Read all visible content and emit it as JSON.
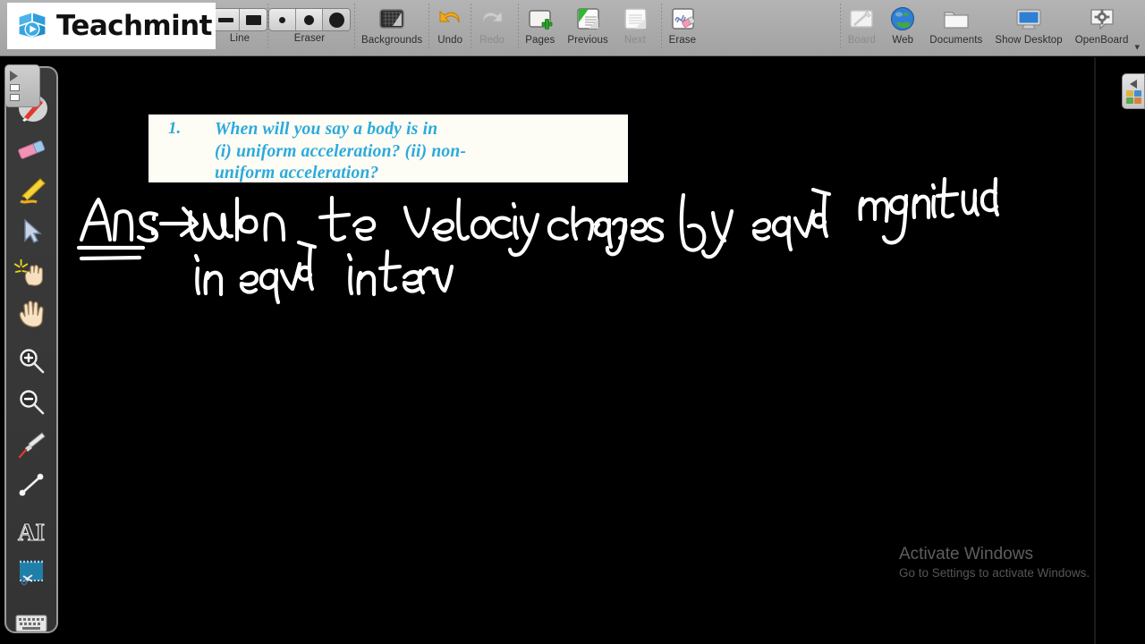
{
  "app": {
    "brand": "Teachmint"
  },
  "toolbar": {
    "groups": [
      {
        "name": "line",
        "label": "Line",
        "icon": "line-width-icon",
        "options": [
          "thin-line",
          "thick-line"
        ],
        "selected": 1
      },
      {
        "name": "eraser",
        "label": "Eraser",
        "icon": "eraser-size-icon",
        "options": [
          "small-dot",
          "medium-dot",
          "large-dot"
        ],
        "selected": 2
      },
      {
        "name": "backgrounds",
        "label": "Backgrounds",
        "icon": "grid-background-icon",
        "disabled": false
      },
      {
        "name": "undo",
        "label": "Undo",
        "icon": "undo-arrow-icon",
        "disabled": false
      },
      {
        "name": "redo",
        "label": "Redo",
        "icon": "redo-arrow-icon",
        "disabled": true
      },
      {
        "name": "pages",
        "label": "Pages",
        "icon": "add-page-icon",
        "disabled": false
      },
      {
        "name": "previous",
        "label": "Previous",
        "icon": "previous-page-icon",
        "disabled": false
      },
      {
        "name": "next",
        "label": "Next",
        "icon": "next-page-icon",
        "disabled": true
      },
      {
        "name": "erase",
        "label": "Erase",
        "icon": "erase-all-icon",
        "disabled": false
      },
      {
        "name": "board",
        "label": "Board",
        "icon": "board-icon",
        "disabled": true
      },
      {
        "name": "web",
        "label": "Web",
        "icon": "globe-icon",
        "disabled": false
      },
      {
        "name": "documents",
        "label": "Documents",
        "icon": "folder-icon",
        "disabled": false
      },
      {
        "name": "show-desktop",
        "label": "Show Desktop",
        "icon": "monitor-icon",
        "disabled": false
      },
      {
        "name": "openboard",
        "label": "OpenBoard",
        "icon": "gear-speech-icon",
        "disabled": false
      }
    ],
    "overflow_caret": "▾"
  },
  "palette": {
    "handle": {
      "arrow": "▶"
    },
    "tools": [
      {
        "name": "pen-tool",
        "label": "Pen",
        "selected": true
      },
      {
        "name": "eraser-tool",
        "label": "Eraser"
      },
      {
        "name": "marker-tool",
        "label": "Marker / Highlighter"
      },
      {
        "name": "select-tool",
        "label": "Selector"
      },
      {
        "name": "pointer-tool",
        "label": "Interact / Click"
      },
      {
        "name": "hand-tool",
        "label": "Hand / Pan"
      },
      {
        "name": "zoom-in-tool",
        "label": "Zoom In"
      },
      {
        "name": "zoom-out-tool",
        "label": "Zoom Out"
      },
      {
        "name": "laser-pointer-tool",
        "label": "Laser Pointer"
      },
      {
        "name": "line-tool",
        "label": "Line"
      },
      {
        "name": "text-tool",
        "label": "Text"
      },
      {
        "name": "capture-tool",
        "label": "Capture Area"
      },
      {
        "name": "keyboard-tool",
        "label": "Virtual Keyboard"
      }
    ]
  },
  "board": {
    "question": {
      "number": "1.",
      "lines": [
        "When will you say a body is in",
        "(i) uniform acceleration?  (ii) non-",
        "uniform acceleration?"
      ],
      "text_color": "#2aaadc",
      "card_bg": "#fdfcf5"
    },
    "handwriting": {
      "ink_color": "#ffffff",
      "line1": "Ans :-> when the velocity changes by equal magnitude",
      "line2": "in equal interv"
    }
  },
  "library_tab": {
    "name": "library-panel-toggle",
    "arrow": "◀"
  },
  "watermark": {
    "title": "Activate Windows",
    "subtitle": "Go to Settings to activate Windows."
  }
}
